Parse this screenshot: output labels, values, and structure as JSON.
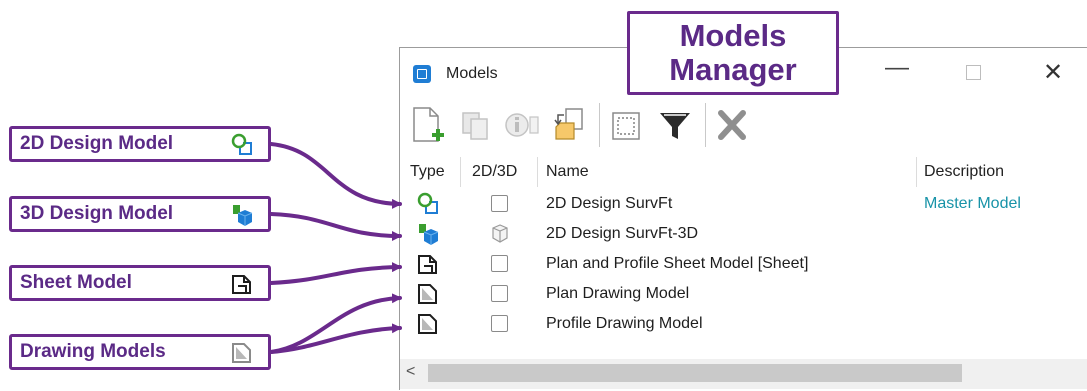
{
  "callout": {
    "line1": "Models",
    "line2": "Manager"
  },
  "window": {
    "title": "Models",
    "minimize_glyph": "—",
    "close_glyph": "✕"
  },
  "toolbar": {
    "icons": [
      "new-model-icon",
      "copy-model-icon",
      "model-properties-icon",
      "import-model-icon",
      "select-all-icon",
      "filter-icon",
      "delete-icon"
    ]
  },
  "table": {
    "columns": [
      "Type",
      "2D/3D",
      "Name",
      "Description"
    ],
    "rows": [
      {
        "type_icon": "2d-design-model-icon",
        "dim": "2D",
        "name": "2D Design SurvFt",
        "description": "Master Model"
      },
      {
        "type_icon": "3d-design-model-icon",
        "dim": "3D",
        "name": "2D Design SurvFt-3D",
        "description": ""
      },
      {
        "type_icon": "sheet-model-icon",
        "dim": "2D",
        "name": "Plan and Profile Sheet Model [Sheet]",
        "description": ""
      },
      {
        "type_icon": "drawing-model-icon",
        "dim": "2D",
        "name": "Plan Drawing Model",
        "description": ""
      },
      {
        "type_icon": "drawing-model-icon",
        "dim": "2D",
        "name": "Profile Drawing Model",
        "description": ""
      }
    ]
  },
  "scrollbar": {
    "left_arrow": "<"
  },
  "legend": [
    {
      "label": "2D Design Model",
      "icon": "2d-design-model-icon"
    },
    {
      "label": "3D Design Model",
      "icon": "3d-design-model-icon"
    },
    {
      "label": "Sheet Model",
      "icon": "sheet-model-icon"
    },
    {
      "label": "Drawing Models",
      "icon": "drawing-model-icon"
    }
  ],
  "colors": {
    "callout_border": "#6a2a8c",
    "callout_text": "#5b2a86",
    "description_text": "#1893a8",
    "icon_green": "#3a9e2f",
    "icon_blue": "#1f7dd4"
  }
}
